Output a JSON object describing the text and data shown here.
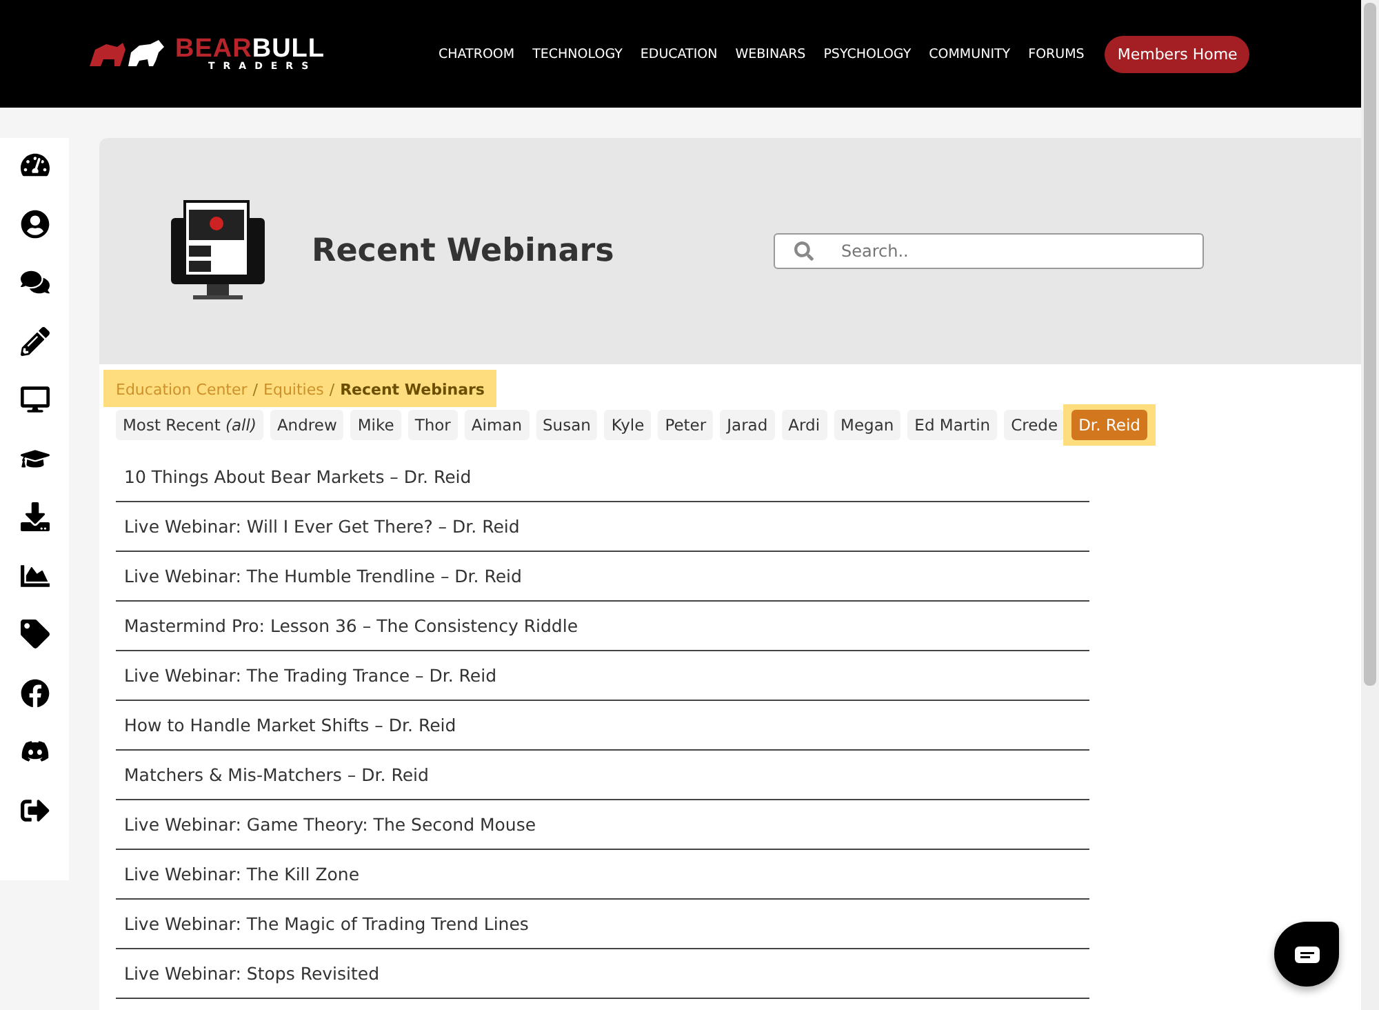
{
  "logo": {
    "primary": "BEAR",
    "secondary": "BULL",
    "tagline": "TRADERS"
  },
  "nav": {
    "links": [
      "CHATROOM",
      "TECHNOLOGY",
      "EDUCATION",
      "WEBINARS",
      "PSYCHOLOGY",
      "COMMUNITY",
      "FORUMS"
    ],
    "button": "Members Home"
  },
  "sidebar": {
    "items": [
      {
        "kind": "dashboard"
      },
      {
        "kind": "profile"
      },
      {
        "kind": "chat"
      },
      {
        "kind": "edit"
      },
      {
        "kind": "monitor"
      },
      {
        "kind": "education"
      },
      {
        "kind": "download"
      },
      {
        "kind": "chart"
      },
      {
        "kind": "tag"
      },
      {
        "kind": "facebook"
      },
      {
        "kind": "discord"
      },
      {
        "kind": "logout"
      }
    ]
  },
  "hero": {
    "title": "Recent Webinars",
    "search": {
      "placeholder": "Search.."
    }
  },
  "breadcrumb": [
    {
      "label": "Education Center",
      "current": false
    },
    {
      "separator": "/",
      "label": "Equities",
      "current": false
    },
    {
      "separator": "/",
      "label": "Recent Webinars",
      "current": true
    }
  ],
  "filters": [
    {
      "label": "Most Recent *(all)*",
      "selected": false
    },
    {
      "label": "Andrew",
      "selected": false
    },
    {
      "label": "Mike",
      "selected": false
    },
    {
      "label": "Thor",
      "selected": false
    },
    {
      "label": "Aiman",
      "selected": false
    },
    {
      "label": "Susan",
      "selected": false
    },
    {
      "label": "Kyle",
      "selected": false
    },
    {
      "label": "Peter",
      "selected": false
    },
    {
      "label": "Jarad",
      "selected": false
    },
    {
      "label": "Ardi",
      "selected": false
    },
    {
      "label": "Megan",
      "selected": false
    },
    {
      "label": "Ed Martin",
      "selected": false
    },
    {
      "label": "Crede",
      "selected": false
    },
    {
      "label": "Dr. Reid",
      "selected": true
    }
  ],
  "webinars": [
    "10 Things About Bear Markets – Dr. Reid",
    "Live Webinar: Will I Ever Get There? – Dr. Reid",
    "Live Webinar: The Humble Trendline – Dr. Reid",
    "Mastermind Pro: Lesson 36 – The Consistency Riddle",
    "Live Webinar: The Trading Trance – Dr. Reid",
    "How to Handle Market Shifts – Dr. Reid",
    "Matchers & Mis-Matchers – Dr. Reid",
    "Live Webinar: Game Theory: The Second Mouse",
    "Live Webinar: The Kill Zone",
    "Live Webinar: The Magic of Trading Trend Lines",
    "Live Webinar: Stops Revisited"
  ]
}
